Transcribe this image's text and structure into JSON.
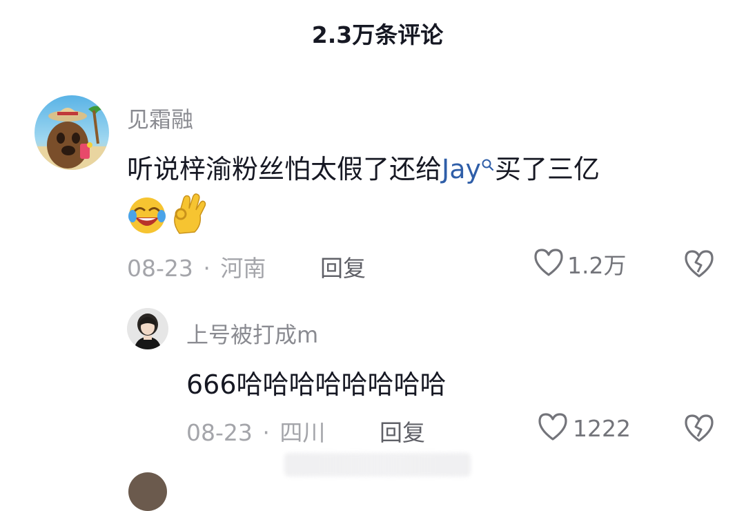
{
  "header": {
    "title": "2.3万条评论"
  },
  "comments": [
    {
      "username": "见霜融",
      "text_before": "听说梓渝粉丝怕太假了还给",
      "mention": "Jay",
      "text_after": "买了三亿",
      "emojis": [
        "laughing-crying-emoji",
        "ok-hand-emoji"
      ],
      "date": "08-23",
      "separator": "·",
      "location": "河南",
      "reply_label": "回复",
      "likes": "1.2万",
      "replies": [
        {
          "username": "上号被打成m",
          "text": "666哈哈哈哈哈哈哈哈",
          "date": "08-23",
          "separator": "·",
          "location": "四川",
          "reply_label": "回复",
          "likes": "1222"
        }
      ]
    }
  ],
  "icons": {
    "like": "heart-outline-icon",
    "dislike": "broken-heart-icon",
    "search": "search-icon"
  },
  "colors": {
    "mention": "#2f5ea8",
    "username": "#8a8b91",
    "meta": "#a4a5aa"
  }
}
